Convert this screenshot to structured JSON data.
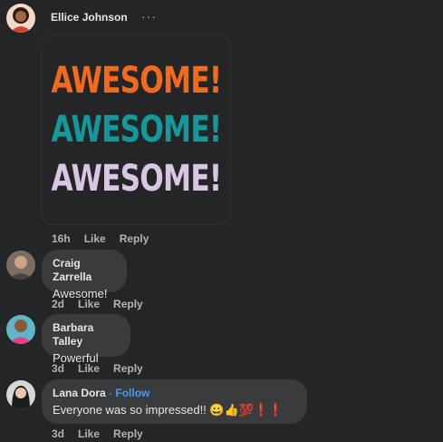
{
  "post": {
    "author": "Ellice Johnson",
    "more": "···",
    "sticker_lines": [
      "AWESOME!",
      "AWESOME!",
      "AWESOME!"
    ],
    "sticker_colors": [
      "#f26a1b",
      "#13999a",
      "#d9c6e3"
    ],
    "time": "16h",
    "like": "Like",
    "reply": "Reply"
  },
  "comments": [
    {
      "author": "Craig Zarrella",
      "text": "Awesome!",
      "time": "2d",
      "like": "Like",
      "reply": "Reply"
    },
    {
      "author": "Barbara Talley",
      "text": "Powerful",
      "time": "3d",
      "like": "Like",
      "reply": "Reply"
    },
    {
      "author": "Lana Dora",
      "separator": "·",
      "follow": "Follow",
      "text": "Everyone was so impressed!! 😀👍💯❗❗",
      "time": "3d",
      "like": "Like",
      "reply": "Reply"
    }
  ]
}
